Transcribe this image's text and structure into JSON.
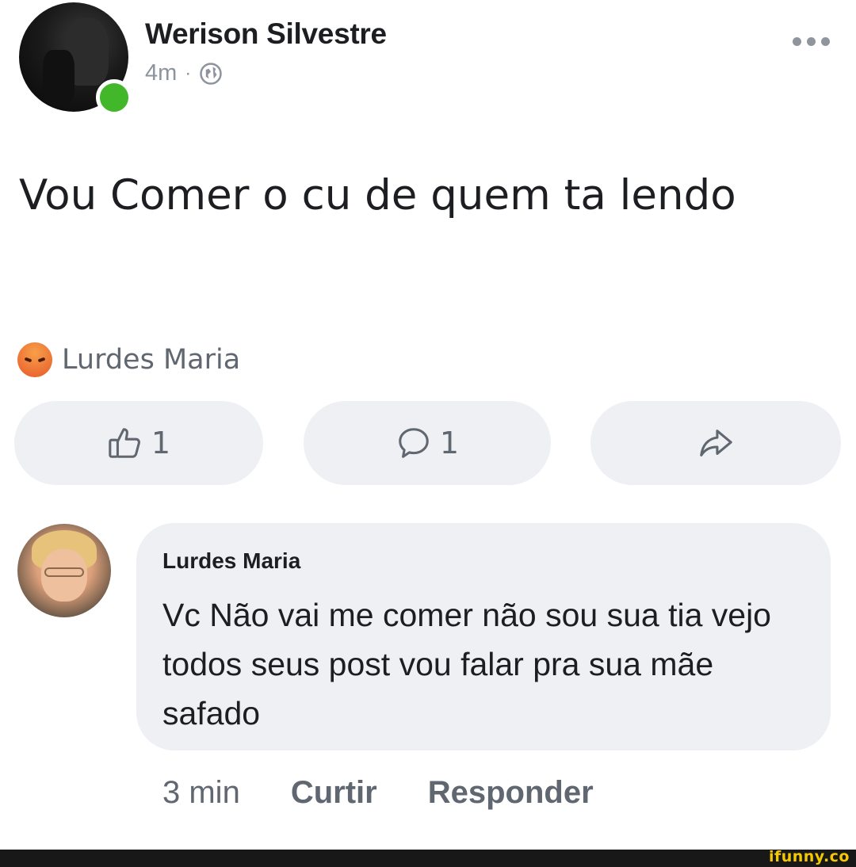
{
  "post": {
    "author": "Werison Silvestre",
    "time": "4m",
    "separator": "·",
    "icons": {
      "privacy": "globe-icon",
      "more": "more-options-icon",
      "status": "online-dot"
    },
    "text": "Vou Comer o cu de quem ta lendo",
    "reaction": {
      "icon": "angry-reaction-icon",
      "name": "Lurdes Maria"
    },
    "actions": {
      "like_count": "1",
      "comment_count": "1"
    }
  },
  "comment": {
    "author": "Lurdes Maria",
    "text": "Vc Não vai me comer não sou sua tia vejo todos seus post vou falar pra sua mãe safado",
    "time": "3 min",
    "like_label": "Curtir",
    "reply_label": "Responder"
  },
  "watermark": "ifunny.co",
  "colors": {
    "online": "#42b72a",
    "pill_bg": "#eef0f3",
    "muted_text": "#606770",
    "watermark": "#f5c800"
  }
}
